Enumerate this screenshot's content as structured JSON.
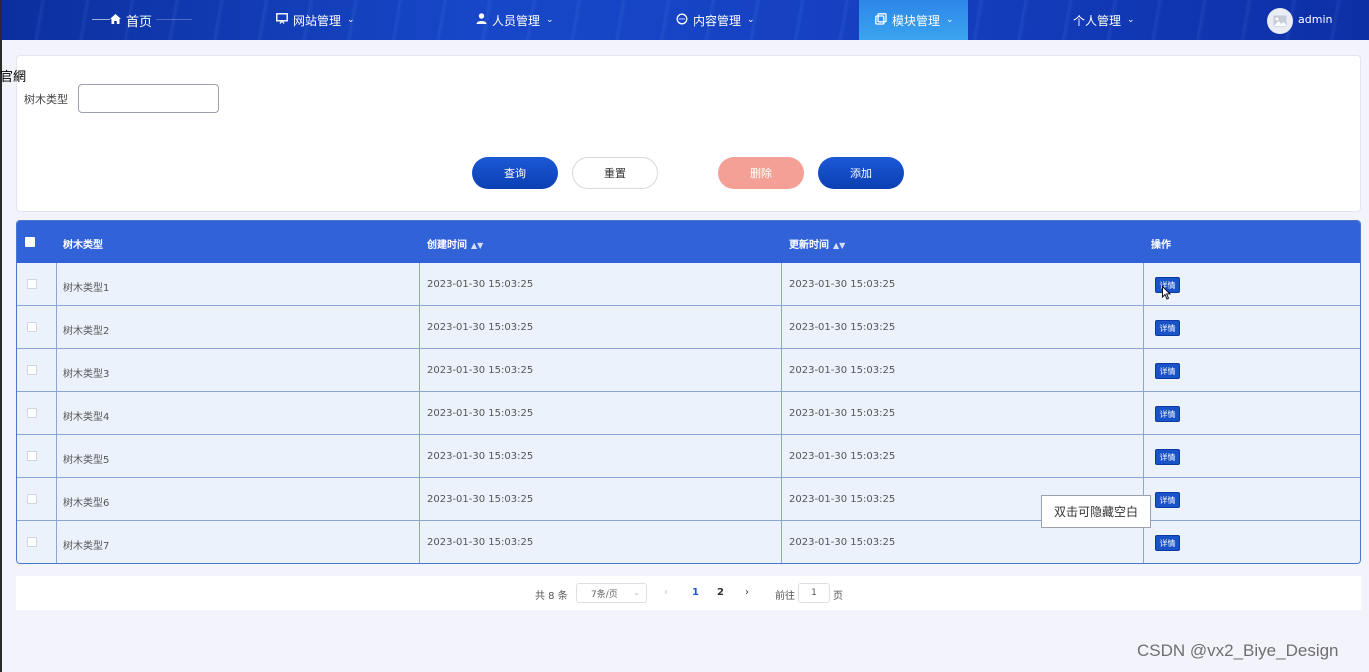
{
  "nav": {
    "home": "首页",
    "items": [
      {
        "label": "网站管理",
        "icon": "monitor-icon"
      },
      {
        "label": "人员管理",
        "icon": "user-icon"
      },
      {
        "label": "内容管理",
        "icon": "chat-icon"
      },
      {
        "label": "模块管理",
        "icon": "module-icon"
      },
      {
        "label": "个人管理",
        "icon": ""
      }
    ],
    "active": "模块管理",
    "active_color": "#36a0ee",
    "username": "admin"
  },
  "stray_text": "官網",
  "search": {
    "label": "树木类型",
    "value": ""
  },
  "buttons": {
    "query": "查询",
    "reset": "重置",
    "delete": "删除",
    "add": "添加"
  },
  "table": {
    "headers": {
      "type": "树木类型",
      "created": "创建时间",
      "updated": "更新时间",
      "action": "操作"
    },
    "action_label": "详情",
    "rows": [
      {
        "type": "树木类型1",
        "created": "2023-01-30 15:03:25",
        "updated": "2023-01-30 15:03:25"
      },
      {
        "type": "树木类型2",
        "created": "2023-01-30 15:03:25",
        "updated": "2023-01-30 15:03:25"
      },
      {
        "type": "树木类型3",
        "created": "2023-01-30 15:03:25",
        "updated": "2023-01-30 15:03:25"
      },
      {
        "type": "树木类型4",
        "created": "2023-01-30 15:03:25",
        "updated": "2023-01-30 15:03:25"
      },
      {
        "type": "树木类型5",
        "created": "2023-01-30 15:03:25",
        "updated": "2023-01-30 15:03:25"
      },
      {
        "type": "树木类型6",
        "created": "2023-01-30 15:03:25",
        "updated": "2023-01-30 15:03:25"
      },
      {
        "type": "树木类型7",
        "created": "2023-01-30 15:03:25",
        "updated": "2023-01-30 15:03:25"
      }
    ]
  },
  "tooltip": "双击可隐藏空白",
  "pagination": {
    "total": "共 8 条",
    "page_size": "7条/页",
    "pages": [
      "1",
      "2"
    ],
    "current": "1",
    "goto_prefix": "前往",
    "goto_value": "1",
    "goto_suffix": "页"
  },
  "watermark": "CSDN @vx2_Biye_Design",
  "colors": {
    "header_bg": "#3262d8",
    "primary": "#1b59d6",
    "delete": "#f5a096"
  }
}
